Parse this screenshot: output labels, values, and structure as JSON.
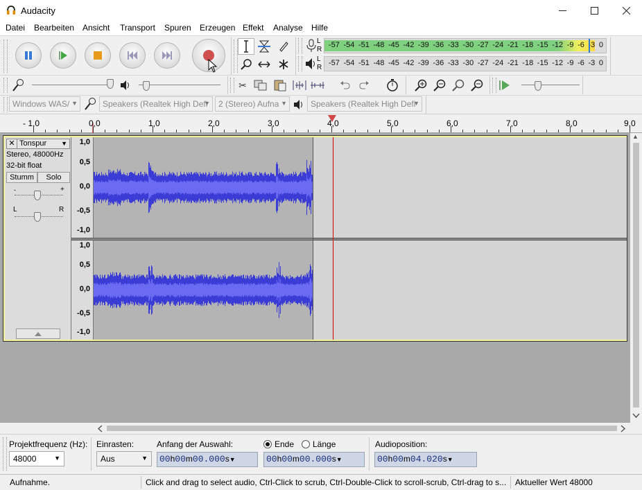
{
  "window": {
    "title": "Audacity",
    "icon": "headphones-icon"
  },
  "menu": [
    "Datei",
    "Bearbeiten",
    "Ansicht",
    "Transport",
    "Spuren",
    "Erzeugen",
    "Effekt",
    "Analyse",
    "Hilfe"
  ],
  "meters": {
    "record_ticks": [
      "-57",
      "-54",
      "-51",
      "-48",
      "-45",
      "-42",
      "-39",
      "-36",
      "-33",
      "-30",
      "-27",
      "-24",
      "-21",
      "-18",
      "-15",
      "-12",
      "-9",
      "-6",
      "-3",
      "0"
    ],
    "play_ticks": [
      "-57",
      "-54",
      "-51",
      "-48",
      "-45",
      "-42",
      "-39",
      "-36",
      "-33",
      "-30",
      "-27",
      "-24",
      "-21",
      "-18",
      "-15",
      "-12",
      "-9",
      "-6",
      "-3",
      "0"
    ],
    "record_channels": [
      "L",
      "R"
    ],
    "play_channels": [
      "L",
      "R"
    ],
    "record_level_fraction": 0.96
  },
  "devices": {
    "host": "Windows WAS/",
    "recording": "Speakers (Realtek High Defi",
    "channels": "2 (Stereo) Aufna",
    "playback": "Speakers (Realtek High Defi"
  },
  "ruler": {
    "labels": [
      "- 1,0",
      "0,0",
      "1,0",
      "2,0",
      "3,0",
      "4,0",
      "5,0",
      "6,0",
      "7,0",
      "8,0",
      "9,0"
    ]
  },
  "track": {
    "name": "Tonspur",
    "info1": "Stereo, 48000Hz",
    "info2": "32-bit float",
    "mute_label": "Stumm",
    "solo_label": "Solo",
    "gain_minus": "-",
    "gain_plus": "+",
    "pan_left": "L",
    "pan_right": "R",
    "scale_labels": [
      "1,0",
      "0,5",
      "0,0",
      "-0,5",
      "-1,0"
    ],
    "audio_end_seconds": 3.65,
    "cursor_seconds": 4.02
  },
  "selection_toolbar": {
    "rate_label": "Projektfrequenz (Hz):",
    "rate_value": "48000",
    "snap_label": "Einrasten:",
    "snap_value": "Aus",
    "start_label": "Anfang der Auswahl:",
    "end_radio": "Ende",
    "length_radio": "Länge",
    "position_label": "Audioposition:",
    "start_time": {
      "h": "00",
      "m": "00",
      "s": "00.000"
    },
    "end_time": {
      "h": "00",
      "m": "00",
      "s": "00.000"
    },
    "audio_position": {
      "h": "00",
      "m": "00",
      "s": "04.020"
    },
    "unit_h": "h",
    "unit_m": "m",
    "unit_s": "s"
  },
  "status": {
    "state": "Aufnahme.",
    "hint": "Click and drag to select audio, Ctrl-Click to scrub, Ctrl-Double-Click to scroll-scrub, Ctrl-drag to s...",
    "value": "Aktueller Wert 48000"
  },
  "colors": {
    "waveform": "#3b3bd6",
    "waveform_rms": "#6a6af2",
    "cursor": "#cc0000",
    "track_border": "#f3f39c"
  }
}
